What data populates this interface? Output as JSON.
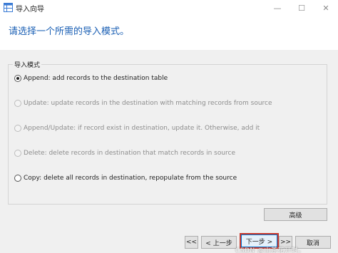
{
  "window": {
    "title": "导入向导",
    "minimize_glyph": "—",
    "maximize_glyph": "☐",
    "close_glyph": "✕"
  },
  "header": {
    "instruction": "请选择一个所需的导入模式。"
  },
  "mode_group": {
    "label": "导入模式",
    "options": [
      {
        "label": "Append: add records to the destination table",
        "selected": true,
        "enabled": true
      },
      {
        "label": "Update: update records in the destination with matching records from source",
        "selected": false,
        "enabled": false
      },
      {
        "label": "Append/Update: if record exist in destination, update it. Otherwise, add it",
        "selected": false,
        "enabled": false
      },
      {
        "label": "Delete: delete records in destination that match records in source",
        "selected": false,
        "enabled": false
      },
      {
        "label": "Copy: delete all records in destination, repopulate from the source",
        "selected": false,
        "enabled": true
      }
    ]
  },
  "buttons": {
    "advanced": "高级",
    "first": "<<",
    "prev": "< 上一步",
    "next": "下一步 >",
    "last": ">>",
    "cancel": "取消"
  },
  "watermark": "CSDN @山茶花开时。",
  "colors": {
    "header_text": "#1a5fb4",
    "panel_bg": "#f0f0f0",
    "highlight_border": "#c8392d"
  }
}
